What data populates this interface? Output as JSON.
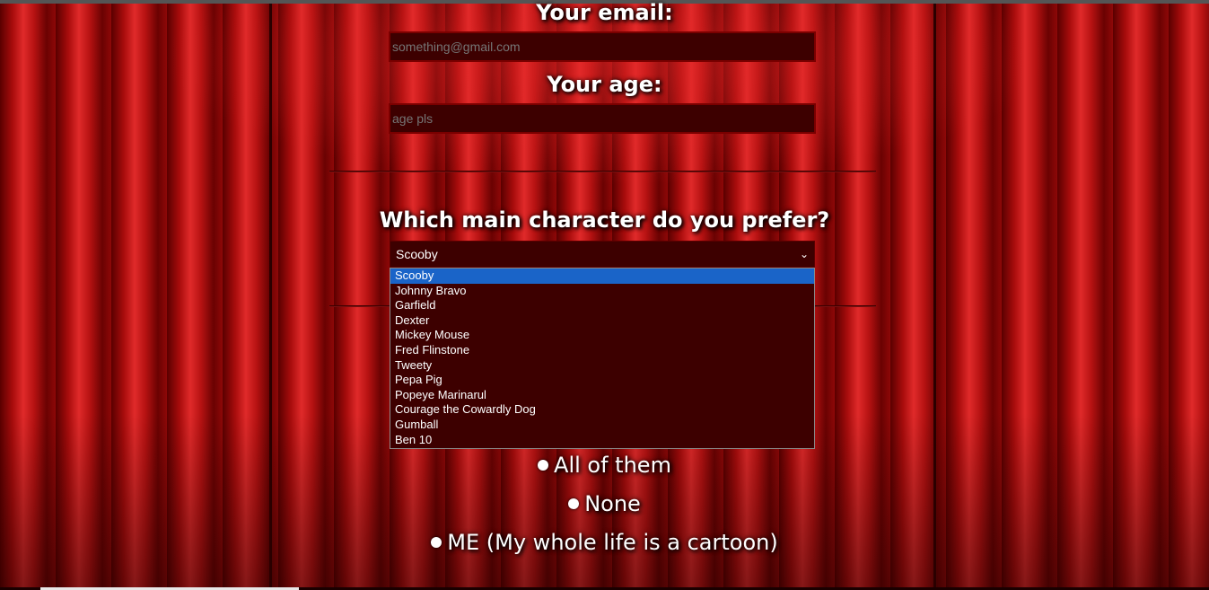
{
  "form": {
    "email_label": "Your email:",
    "email_placeholder": "something@gmail.com",
    "age_label": "Your age:",
    "age_placeholder": "age pls",
    "character_question": "Which main character do you prefer?",
    "selected_character": "Scooby",
    "character_options": [
      "Scooby",
      "Johnny Bravo",
      "Garfield",
      "Dexter",
      "Mickey Mouse",
      "Fred Flinstone",
      "Tweety",
      "Pepa Pig",
      "Popeye Marinarul",
      "Courage the Cowardly Dog",
      "Gumball",
      "Ben 10"
    ],
    "radio_options": [
      "All of them",
      "None",
      "ME (My whole life is a cartoon)"
    ]
  },
  "icons": {
    "select_arrow": "chevron-down-icon"
  },
  "colors": {
    "input_bg": "#3d0000",
    "highlight": "#1a64c8",
    "text": "#ffffff"
  }
}
